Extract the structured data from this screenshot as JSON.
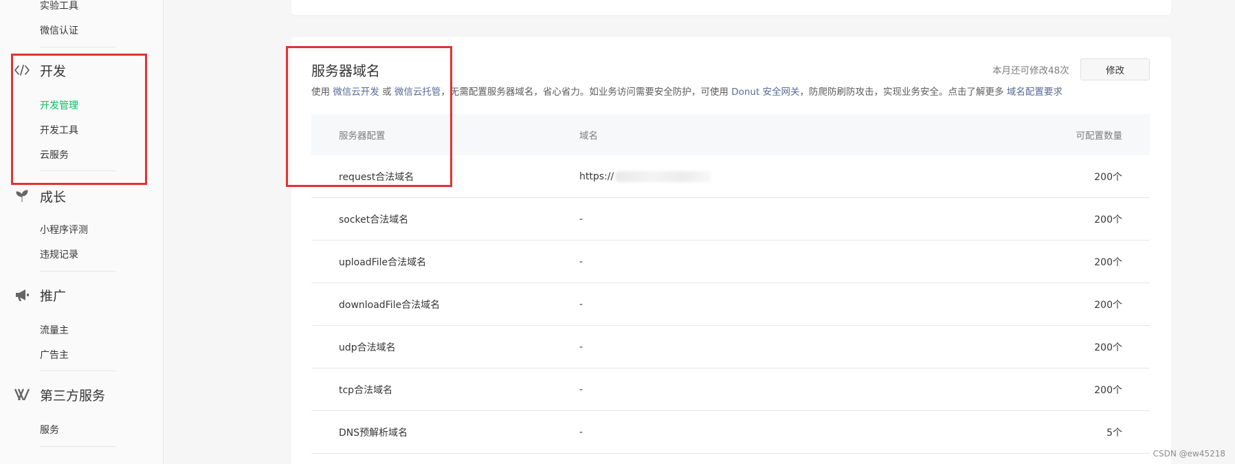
{
  "sidebar": {
    "top_items": [
      "实验工具",
      "微信认证"
    ],
    "groups": [
      {
        "label": "开发",
        "icon": "code-icon",
        "items": [
          "开发管理",
          "开发工具",
          "云服务"
        ],
        "active": "开发管理"
      },
      {
        "label": "成长",
        "icon": "sprout-icon",
        "items": [
          "小程序评测",
          "违规记录"
        ]
      },
      {
        "label": "推广",
        "icon": "megaphone-icon",
        "items": [
          "流量主",
          "广告主"
        ]
      },
      {
        "label": "第三方服务",
        "icon": "third-party-icon",
        "items": [
          "服务"
        ]
      }
    ]
  },
  "section": {
    "title": "服务器域名",
    "desc": {
      "p1": "使用 ",
      "link1": "微信云开发",
      "p2": " 或 ",
      "link2": "微信云托管",
      "p3": "，无需配置服务器域名，省心省力。如业务访问需要安全防护，可使用 ",
      "link3": "Donut 安全网关",
      "p4": "，防爬防刷防攻击，实现业务安全。点击了解更多 ",
      "link4": "域名配置要求"
    },
    "quota_text": "本月还可修改48次",
    "modify_label": "修改"
  },
  "table": {
    "headers": [
      "服务器配置",
      "域名",
      "可配置数量"
    ],
    "rows": [
      {
        "config": "request合法域名",
        "domain": "https://",
        "count": "200个",
        "domain_redacted": true
      },
      {
        "config": "socket合法域名",
        "domain": "-",
        "count": "200个"
      },
      {
        "config": "uploadFile合法域名",
        "domain": "-",
        "count": "200个"
      },
      {
        "config": "downloadFile合法域名",
        "domain": "-",
        "count": "200个"
      },
      {
        "config": "udp合法域名",
        "domain": "-",
        "count": "200个"
      },
      {
        "config": "tcp合法域名",
        "domain": "-",
        "count": "200个"
      },
      {
        "config": "DNS预解析域名",
        "domain": "-",
        "count": "5个"
      }
    ]
  },
  "watermark": "CSDN @ew45218",
  "colors": {
    "active_green": "#07c160",
    "link_blue": "#576b95",
    "annotation_red": "#e23131"
  }
}
